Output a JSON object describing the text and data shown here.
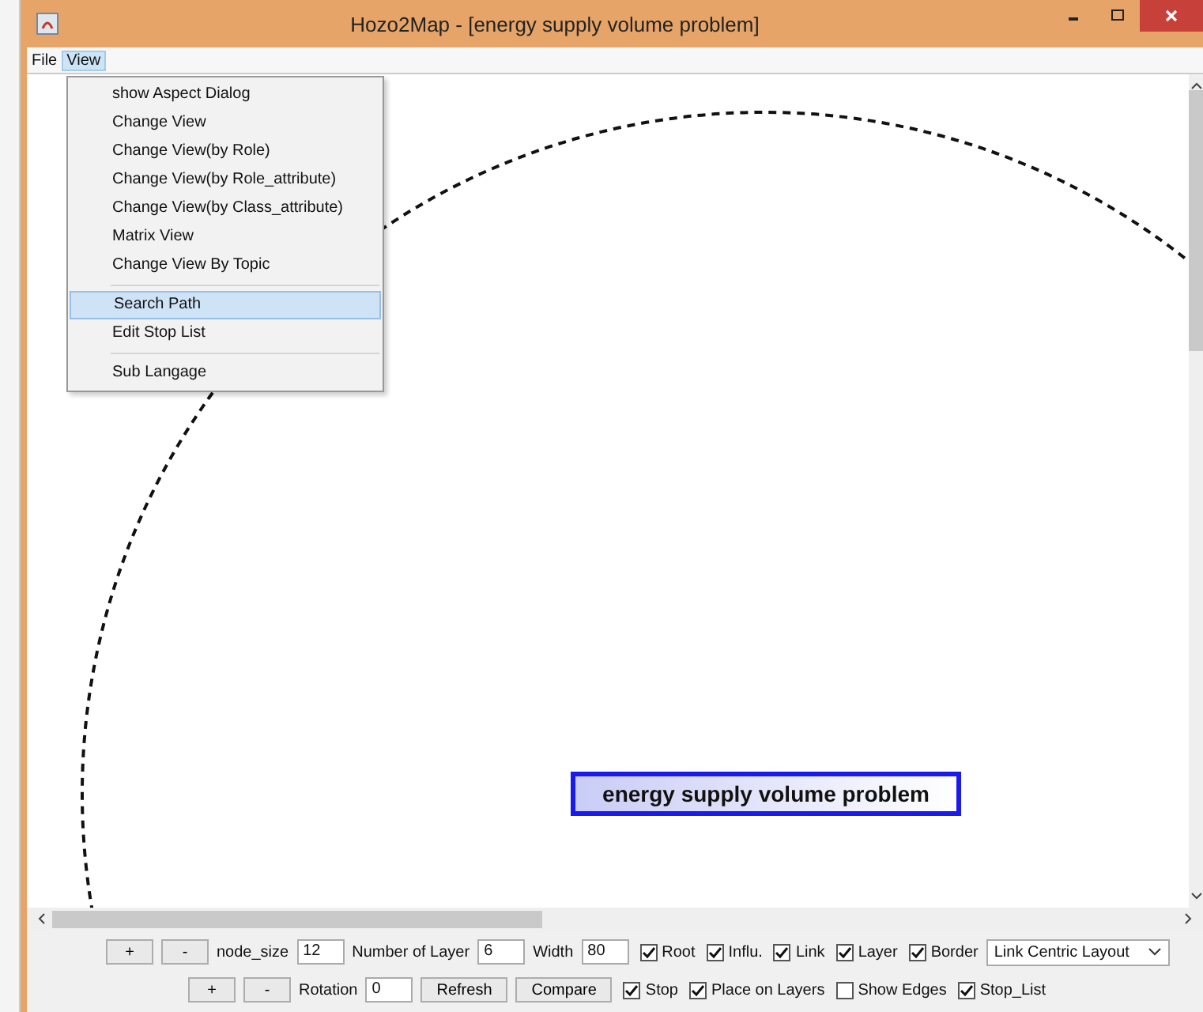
{
  "window": {
    "title": "Hozo2Map - [energy supply volume problem]"
  },
  "menu_bar": [
    {
      "label": "File",
      "selected": false
    },
    {
      "label": "View",
      "selected": true
    }
  ],
  "view_menu": {
    "groups": [
      [
        {
          "label": "show Aspect Dialog",
          "selected": false
        },
        {
          "label": "Change View",
          "selected": false
        },
        {
          "label": "Change View(by Role)",
          "selected": false
        },
        {
          "label": "Change View(by Role_attribute)",
          "selected": false
        },
        {
          "label": "Change View(by Class_attribute)",
          "selected": false
        },
        {
          "label": "Matrix View",
          "selected": false
        },
        {
          "label": "Change View By Topic",
          "selected": false
        }
      ],
      [
        {
          "label": "Search Path",
          "selected": true
        },
        {
          "label": "Edit Stop List",
          "selected": false
        }
      ],
      [
        {
          "label": "Sub Langage",
          "selected": false
        }
      ]
    ]
  },
  "canvas": {
    "node": {
      "label": "energy supply volume problem"
    }
  },
  "toolbar_rows": [
    [
      {
        "kind": "button",
        "label": "+"
      },
      {
        "kind": "button",
        "label": "-"
      },
      {
        "kind": "label",
        "label": "node_size"
      },
      {
        "kind": "field",
        "value": "12"
      },
      {
        "kind": "label",
        "label": "Number of Layer"
      },
      {
        "kind": "field",
        "value": "6"
      },
      {
        "kind": "label",
        "label": "Width"
      },
      {
        "kind": "field",
        "value": "80"
      },
      {
        "kind": "checkbox",
        "label": "Root",
        "checked": true
      },
      {
        "kind": "checkbox",
        "label": "Influ.",
        "checked": true
      },
      {
        "kind": "checkbox",
        "label": "Link",
        "checked": true
      },
      {
        "kind": "checkbox",
        "label": "Layer",
        "checked": true
      },
      {
        "kind": "checkbox",
        "label": "Border",
        "checked": true
      },
      {
        "kind": "dropdown",
        "value": "Link Centric Layout"
      }
    ],
    [
      {
        "kind": "button",
        "label": "+"
      },
      {
        "kind": "button",
        "label": "-"
      },
      {
        "kind": "label",
        "label": "Rotation"
      },
      {
        "kind": "field",
        "value": "0"
      },
      {
        "kind": "button",
        "label": "Refresh"
      },
      {
        "kind": "button",
        "label": "Compare"
      },
      {
        "kind": "checkbox",
        "label": "Stop",
        "checked": true
      },
      {
        "kind": "checkbox",
        "label": "Place on Layers",
        "checked": true
      },
      {
        "kind": "checkbox",
        "label": "Show Edges",
        "checked": false
      },
      {
        "kind": "checkbox",
        "label": "Stop_List",
        "checked": true
      }
    ]
  ]
}
